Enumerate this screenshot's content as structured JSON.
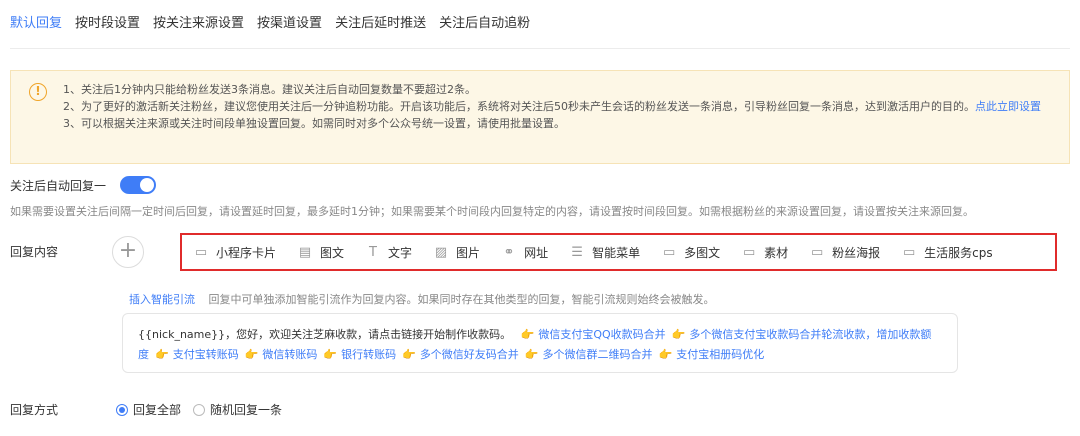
{
  "tabs": [
    {
      "label": "默认回复",
      "active": true
    },
    {
      "label": "按时段设置"
    },
    {
      "label": "按关注来源设置"
    },
    {
      "label": "按渠道设置"
    },
    {
      "label": "关注后延时推送"
    },
    {
      "label": "关注后自动追粉"
    }
  ],
  "notice": {
    "line1": "1、关注后1分钟内只能给粉丝发送3条消息。建议关注后自动回复数量不要超过2条。",
    "line2_text": "2、为了更好的激活新关注粉丝，建议您使用关注后一分钟追粉功能。开启该功能后，系统将对关注后50秒未产生会话的粉丝发送一条消息，引导粉丝回复一条消息，达到激活用户的目的。",
    "line2_link": "点此立即设置",
    "line3": "3、可以根据关注来源或关注时间段单独设置回复。如需同时对多个公众号统一设置，请使用批量设置。"
  },
  "auto_reply": {
    "label": "关注后自动回复一",
    "enabled": true
  },
  "hint": "如果需要设置关注后间隔一定时间后回复，请设置延时回复，最多延时1分钟；如果需要某个时间段内回复特定的内容，请设置按时间段回复。如需根据粉丝的来源设置回复，请设置按关注来源回复。",
  "reply_content": {
    "label": "回复内容",
    "plus": "+",
    "types": [
      {
        "icon": "mini-program-card-icon",
        "glyph": "▭",
        "label": "小程序卡片"
      },
      {
        "icon": "image-text-icon",
        "glyph": "▤",
        "label": "图文"
      },
      {
        "icon": "text-icon",
        "glyph": "T",
        "label": "文字"
      },
      {
        "icon": "image-icon",
        "glyph": "▨",
        "label": "图片"
      },
      {
        "icon": "link-icon",
        "glyph": "⚭",
        "label": "网址"
      },
      {
        "icon": "menu-icon",
        "glyph": "☰",
        "label": "智能菜单"
      },
      {
        "icon": "multi-image-text-icon",
        "glyph": "▭",
        "label": "多图文"
      },
      {
        "icon": "material-icon",
        "glyph": "▭",
        "label": "素材"
      },
      {
        "icon": "poster-icon",
        "glyph": "▭",
        "label": "粉丝海报"
      },
      {
        "icon": "cps-icon",
        "glyph": "▭",
        "label": "生活服务cps"
      }
    ]
  },
  "smart": {
    "link": "插入智能引流",
    "desc": "回复中可单独添加智能引流作为回复内容。如果同时存在其他类型的回复，智能引流规则始终会被触发。"
  },
  "message": {
    "prefix": "{{nick_name}}，您好，欢迎关注芝麻收款，请点击链接开始制作收款码。",
    "hand": "👉",
    "links": [
      "微信支付宝QQ收款码合并",
      "多个微信支付宝收款码合并轮流收款，增加收款额度",
      "支付宝转账码",
      "微信转账码",
      "银行转账码",
      "多个微信好友码合并",
      "多个微信群二维码合并",
      "支付宝相册码优化"
    ]
  },
  "reply_mode": {
    "label": "回复方式",
    "options": [
      {
        "label": "回复全部",
        "selected": true
      },
      {
        "label": "随机回复一条",
        "selected": false
      }
    ]
  },
  "colors": {
    "accent": "#3f7df7",
    "highlight_border": "#e02b2b",
    "notice_bg": "#fdf7e6"
  }
}
